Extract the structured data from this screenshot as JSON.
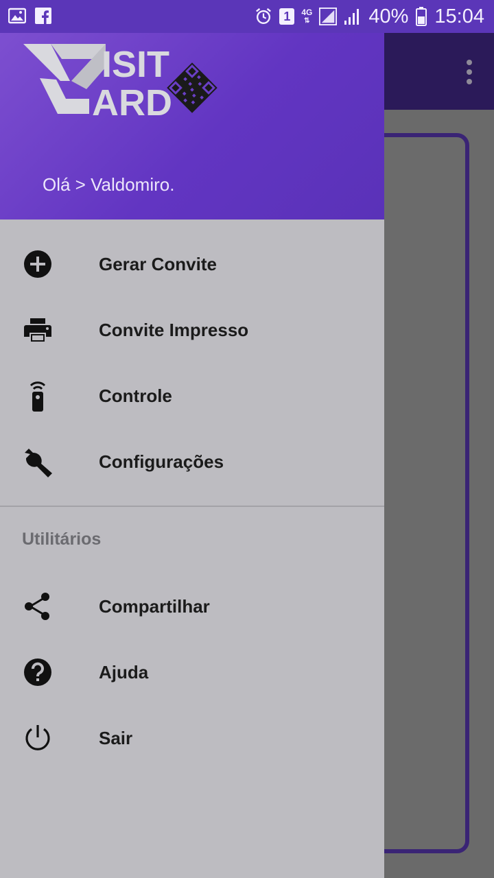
{
  "status_bar": {
    "sim_badge": "1",
    "network": "4G",
    "battery_percent": "40%",
    "time": "15:04"
  },
  "drawer": {
    "logo_text": {
      "line1": "ISIT",
      "line2": "ARD"
    },
    "greeting": "Olá > Valdomiro.",
    "items": [
      {
        "label": "Gerar Convite",
        "icon": "add-circle-icon"
      },
      {
        "label": "Convite Impresso",
        "icon": "printer-icon"
      },
      {
        "label": "Controle",
        "icon": "remote-control-icon"
      },
      {
        "label": "Configurações",
        "icon": "wrench-icon"
      }
    ],
    "section_title": "Utilitários",
    "utility_items": [
      {
        "label": "Compartilhar",
        "icon": "share-icon"
      },
      {
        "label": "Ajuda",
        "icon": "help-icon"
      },
      {
        "label": "Sair",
        "icon": "power-icon"
      }
    ]
  },
  "colors": {
    "header_purple": "#6235c2",
    "drawer_bg": "#bdbcc1",
    "toolbar_dark": "#2b1a59"
  }
}
